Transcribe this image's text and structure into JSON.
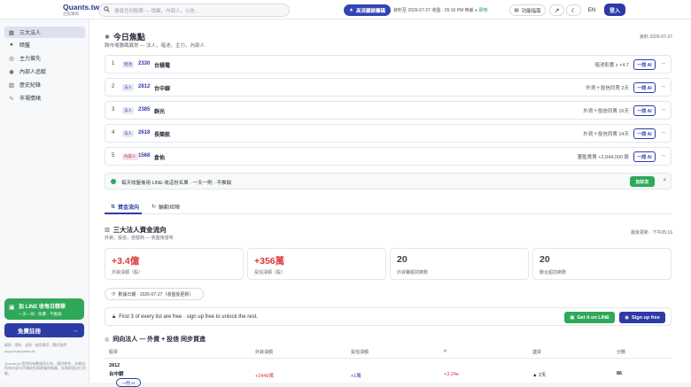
{
  "header": {
    "logo_title": "Quants.tw",
    "logo_sub": "台股籌碼",
    "search_placeholder": "搜尋任何股票 — 請鍵，內部人，公告...",
    "upgrade_label": "高流顯錶籌碼",
    "status": "資料至 2026-07-27 收盤 · 05:16 PM 時差",
    "status_live": "● 即時",
    "guide_label": "功能指南",
    "lang_label": "EN",
    "login_label": "登入"
  },
  "sidebar": {
    "items": [
      {
        "label": "三大法人",
        "icon": "▦",
        "active": true
      },
      {
        "label": "暗盤",
        "icon": "●",
        "active": false
      },
      {
        "label": "主力搶先",
        "icon": "◎",
        "active": false
      },
      {
        "label": "內部人追蹤",
        "icon": "◉",
        "active": false
      },
      {
        "label": "歷史紀錄",
        "icon": "▥",
        "active": false
      },
      {
        "label": "市場情緒",
        "icon": "∿",
        "active": false
      }
    ],
    "line_cta_title": "加 LINE 收每日精華",
    "line_cta_sub": "一天一則 · 免費 · 不推銷",
    "register_label": "免費註冊",
    "footer_links": "條款 · 隱私 · 退款 · 使用費用 · 關於我們",
    "footer_email": "support@quants.tw",
    "footer_note": "Quants.tw 提供所有數據與分析，僅供參考，本網站所有內容均不構成投資建議與推薦，投資前請自行判斷。"
  },
  "focus": {
    "title": "今日焦點",
    "subtitle": "跨市場籌碼異常 — 法人，暗池，主力，內部人",
    "date": "資料 2026-07-27",
    "items": [
      {
        "n": "1",
        "tag": "暗池",
        "tag_type": "dark",
        "code": "2330",
        "name": "台積電",
        "desc": "暗池影響 z +4.7"
      },
      {
        "n": "2",
        "tag": "法人",
        "tag_type": "inst",
        "code": "2812",
        "name": "台中銀",
        "desc": "外資＋投信同買 2天"
      },
      {
        "n": "3",
        "tag": "法人",
        "tag_type": "inst",
        "code": "2385",
        "name": "群光",
        "desc": "外資＋投信同賣 16天"
      },
      {
        "n": "4",
        "tag": "法人",
        "tag_type": "inst",
        "code": "2618",
        "name": "長榮航",
        "desc": "外資＋投信同賣 14天"
      },
      {
        "n": "5",
        "tag": "內部人",
        "tag_type": "ins",
        "code": "1568",
        "name": "倉佑",
        "desc": "董監賣賣 +2,044,000 股"
      }
    ],
    "ai_label": "一問 AI"
  },
  "banner": {
    "message": "每天收盤後用 LINE 收這份名單 · 一天一則 · 不推銷",
    "add_label": "加好友",
    "close": "×"
  },
  "tabs": [
    {
      "label": "資金流向",
      "icon": "⇅"
    },
    {
      "label": "輪動矩陣",
      "icon": "↻"
    }
  ],
  "flow": {
    "title": "三大法人資金流向",
    "subtitle": "外資，投信，自營商 — 收盤後發布",
    "updated": "最後更新 · 下午05:16",
    "cards": [
      {
        "value": "+3.4億",
        "label": "外資淨額（股）",
        "red": true
      },
      {
        "value": "+356萬",
        "label": "投信淨額（股）",
        "red": true
      },
      {
        "value": "20",
        "label": "外資賽超前席數",
        "red": false
      },
      {
        "value": "20",
        "label": "聯合超前席數",
        "red": false
      }
    ],
    "date_pill": "數據日期 · 2026-07-27（收盤後更新）"
  },
  "unlock": {
    "message": "First 3 of every list are free · sign up free to unlock the rest.",
    "line_label": "Get it on LINE",
    "signup_label": "Sign up free"
  },
  "sync": {
    "title": "同向法人 — 外資 + 投信 同步買進",
    "headers": [
      "股票",
      "外資淨額",
      "投信淨額",
      "#",
      "連買",
      "分數"
    ],
    "rows": [
      {
        "code": "2812",
        "name": "台中銀",
        "foreign": "+2449萬",
        "trust": "+1萬",
        "hash": "+3.24e",
        "streak": "▲ 2天",
        "score": "86"
      }
    ]
  }
}
